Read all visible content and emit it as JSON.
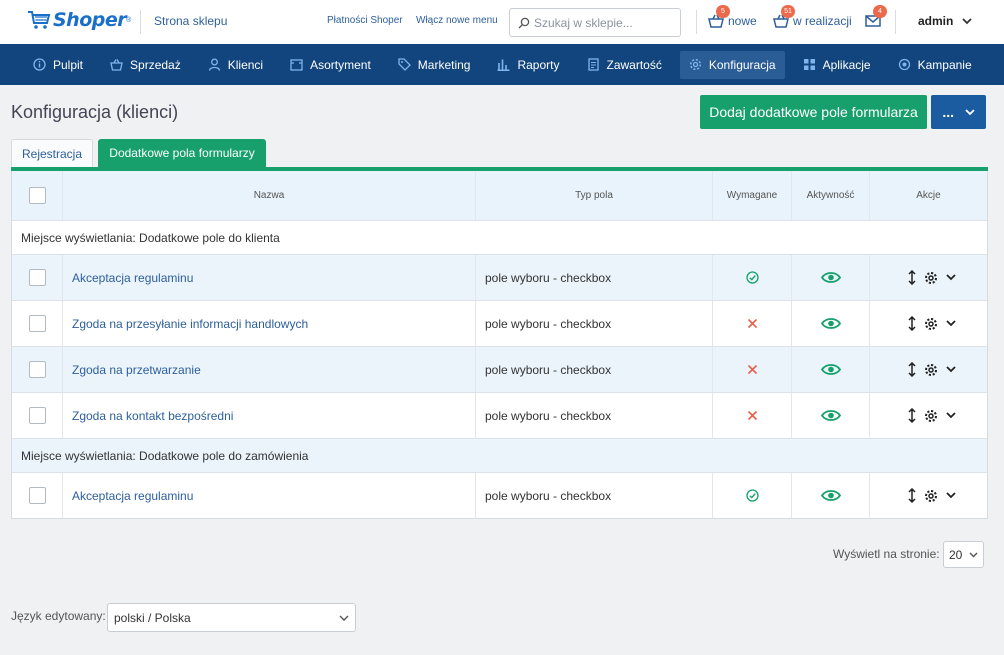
{
  "topbar": {
    "logo_text": "Shoper",
    "logo_reg": "®",
    "store_link": "Strona sklepu",
    "payments_link": "Płatności Shoper",
    "new_menu_link": "Włącz nowe menu",
    "search_placeholder": "Szukaj w sklepie...",
    "orders_new": {
      "label": "nowe",
      "count": "5"
    },
    "orders_processing": {
      "label": "w realizacji",
      "count": "51"
    },
    "messages": {
      "count": "4"
    },
    "user": "admin"
  },
  "nav": {
    "items": [
      {
        "label": "Pulpit",
        "icon": "info-circle-icon"
      },
      {
        "label": "Sprzedaż",
        "icon": "basket-icon"
      },
      {
        "label": "Klienci",
        "icon": "user-icon"
      },
      {
        "label": "Asortyment",
        "icon": "box-icon"
      },
      {
        "label": "Marketing",
        "icon": "tag-icon"
      },
      {
        "label": "Raporty",
        "icon": "bar-chart-icon"
      },
      {
        "label": "Zawartość",
        "icon": "document-icon"
      },
      {
        "label": "Konfiguracja",
        "icon": "gear-icon",
        "active": true
      },
      {
        "label": "Aplikacje",
        "icon": "grid-icon"
      },
      {
        "label": "Kampanie",
        "icon": "target-icon"
      }
    ]
  },
  "page": {
    "title": "Konfiguracja (klienci)",
    "add_button": "Dodaj dodatkowe pole formularza",
    "more_button": "..."
  },
  "tabs": [
    {
      "label": "Rejestracja",
      "active": false
    },
    {
      "label": "Dodatkowe pola formularzy",
      "active": true
    }
  ],
  "table": {
    "headers": {
      "name": "Nazwa",
      "type": "Typ pola",
      "required": "Wymagane",
      "active": "Aktywność",
      "actions": "Akcje"
    },
    "groups": [
      {
        "label": "Miejsce wyświetlania: Dodatkowe pole do klienta",
        "rows": [
          {
            "name": "Akceptacja regulaminu",
            "type": "pole wyboru - checkbox",
            "required": true
          },
          {
            "name": "Zgoda na przesyłanie informacji handlowych",
            "type": "pole wyboru - checkbox",
            "required": false
          },
          {
            "name": "Zgoda na przetwarzanie",
            "type": "pole wyboru - checkbox",
            "required": false
          },
          {
            "name": "Zgoda na kontakt bezpośredni",
            "type": "pole wyboru - checkbox",
            "required": false
          }
        ]
      },
      {
        "label": "Miejsce wyświetlania: Dodatkowe pole do zamówienia",
        "rows": [
          {
            "name": "Akceptacja regulaminu",
            "type": "pole wyboru - checkbox",
            "required": true
          }
        ]
      }
    ]
  },
  "pagination": {
    "label": "Wyświetl na stronie:",
    "value": "20"
  },
  "language": {
    "label": "Język edytowany:",
    "value": "polski / Polska"
  },
  "colors": {
    "primary_green": "#17a06c",
    "nav_blue": "#12457d",
    "link_blue": "#2d5f9a",
    "badge_orange": "#ec6a4c",
    "error_red": "#e8604c"
  }
}
